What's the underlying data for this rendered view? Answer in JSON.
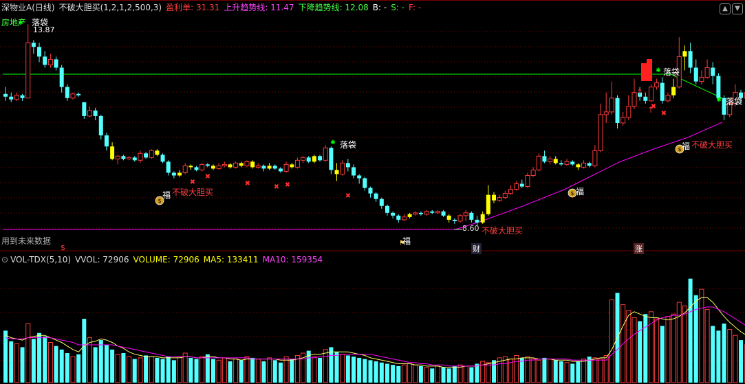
{
  "main_header": {
    "title": "深物业A(日线)",
    "indicator": "不破大胆买(1,2,1,2,500,3)",
    "profit_label": "盈利单",
    "profit_value": "31.31",
    "up_label": "上升趋势线",
    "up_value": "11.47",
    "down_label": "下降趋势线",
    "down_value": "12.08",
    "b_label": "B: -",
    "s_label": "S: -",
    "f_label": "F: -"
  },
  "sector_label": "房地产",
  "price_max_label": "13.87",
  "future_data_note": "用到未来数据",
  "annotations": {
    "luodai": "落袋",
    "fu": "福",
    "buy": "不破大胆买",
    "low_price": "8.60"
  },
  "markers": {
    "m1": "$",
    "m2": "财",
    "m3": "涨"
  },
  "vol_header": {
    "name": "VOL-TDX(5,10)",
    "vvol_label": "VVOL",
    "vvol_value": "72906",
    "volume_label": "VOLUME",
    "volume_value": "72906",
    "ma5_label": "MA5",
    "ma5_value": "133411",
    "ma10_label": "MA10",
    "ma10_value": "159354"
  },
  "colors": {
    "up": "#ff3c3c",
    "down": "#54ffff",
    "yellow": "#ffff00",
    "magenta": "#ff00ff",
    "green": "#00ff00",
    "white": "#ffffff",
    "grid": "#8b0000",
    "ma5": "#ffffff",
    "ma10": "#ff00ff"
  },
  "chart_data": {
    "type": "candlestick",
    "price_label_high": 13.87,
    "price_label_low": 8.6,
    "candles": [
      [
        11.35,
        11.25,
        11.6,
        11.1
      ],
      [
        11.25,
        11.15,
        11.4,
        11.05
      ],
      [
        11.15,
        11.3,
        11.4,
        11.1
      ],
      [
        11.3,
        11.2,
        11.35,
        11.1
      ],
      [
        11.2,
        13.2,
        13.87,
        11.2
      ],
      [
        13.2,
        13.05,
        13.3,
        12.8
      ],
      [
        13.05,
        12.7,
        13.2,
        12.5
      ],
      [
        12.7,
        12.4,
        12.9,
        12.3
      ],
      [
        12.4,
        12.6,
        12.8,
        12.3
      ],
      [
        12.6,
        12.3,
        12.7,
        12.2
      ],
      [
        12.3,
        11.6,
        12.4,
        11.4
      ],
      [
        11.6,
        11.2,
        11.7,
        11.1
      ],
      [
        11.2,
        11.35,
        11.4,
        11.15
      ],
      [
        11.35,
        11.3,
        11.4,
        11.25
      ],
      [
        11.05,
        10.55,
        11.05,
        10.45
      ],
      [
        10.55,
        10.75,
        10.9,
        10.5
      ],
      [
        10.75,
        10.55,
        10.85,
        10.4
      ],
      [
        10.55,
        9.85,
        10.6,
        9.7
      ],
      [
        9.85,
        9.45,
        9.95,
        9.3
      ],
      [
        9.45,
        9.0,
        9.6,
        8.95
      ],
      [
        9.0,
        9.1,
        9.15,
        8.8
      ],
      [
        9.1,
        9.0,
        9.15,
        8.95
      ],
      [
        9.0,
        9.05,
        9.1,
        8.95
      ],
      [
        9.05,
        8.95,
        9.1,
        8.9
      ],
      [
        8.95,
        9.2,
        9.3,
        8.85
      ],
      [
        9.2,
        9.05,
        9.25,
        9.0
      ],
      [
        9.05,
        9.3,
        9.35,
        9.0
      ],
      [
        9.3,
        9.15,
        9.35,
        9.1
      ],
      [
        9.15,
        8.9,
        9.2,
        8.85
      ],
      [
        8.9,
        8.5,
        8.95,
        8.4
      ],
      [
        8.5,
        8.4,
        8.55,
        8.3
      ],
      [
        8.4,
        8.5,
        8.6,
        8.35
      ],
      [
        8.5,
        8.75,
        8.85,
        8.45
      ],
      [
        8.75,
        8.7,
        8.8,
        8.6
      ],
      [
        8.7,
        8.6,
        8.75,
        8.55
      ],
      [
        8.6,
        8.8,
        8.85,
        8.55
      ],
      [
        8.8,
        8.75,
        8.85,
        8.7
      ],
      [
        8.75,
        8.65,
        8.8,
        8.6
      ],
      [
        8.65,
        8.75,
        8.85,
        8.6
      ],
      [
        8.75,
        8.8,
        8.9,
        8.7
      ],
      [
        8.8,
        8.7,
        8.85,
        8.65
      ],
      [
        8.7,
        8.85,
        8.9,
        8.65
      ],
      [
        8.85,
        8.75,
        8.9,
        8.7
      ],
      [
        8.75,
        8.9,
        8.95,
        8.7
      ],
      [
        8.9,
        8.7,
        8.95,
        8.65
      ],
      [
        8.7,
        8.75,
        8.85,
        8.65
      ],
      [
        8.75,
        8.65,
        8.8,
        8.55
      ],
      [
        8.65,
        8.75,
        8.85,
        8.6
      ],
      [
        8.75,
        8.65,
        8.8,
        8.6
      ],
      [
        8.65,
        8.55,
        8.7,
        8.5
      ],
      [
        8.55,
        8.8,
        8.9,
        8.5
      ],
      [
        8.8,
        8.7,
        8.85,
        8.65
      ],
      [
        8.7,
        8.95,
        9.05,
        8.65
      ],
      [
        8.95,
        9.05,
        9.1,
        8.85
      ],
      [
        9.05,
        8.9,
        9.1,
        8.85
      ],
      [
        8.9,
        9.1,
        9.15,
        8.85
      ],
      [
        9.1,
        8.95,
        9.15,
        8.9
      ],
      [
        8.95,
        9.4,
        9.5,
        8.9
      ],
      [
        9.4,
        8.6,
        9.45,
        8.45
      ],
      [
        8.6,
        8.45,
        8.85,
        8.2
      ],
      [
        8.45,
        8.85,
        8.95,
        8.4
      ],
      [
        8.85,
        8.7,
        9.0,
        8.55
      ],
      [
        8.7,
        8.4,
        8.8,
        8.3
      ],
      [
        8.4,
        8.3,
        8.45,
        8.1
      ],
      [
        8.3,
        7.95,
        8.35,
        7.85
      ],
      [
        7.95,
        7.75,
        8.0,
        7.6
      ],
      [
        7.75,
        7.55,
        7.8,
        7.45
      ],
      [
        7.55,
        7.3,
        7.6,
        7.2
      ],
      [
        7.3,
        7.05,
        7.35,
        6.95
      ],
      [
        7.05,
        6.95,
        7.1,
        6.85
      ],
      [
        6.95,
        6.8,
        7.0,
        6.7
      ],
      [
        6.8,
        6.9,
        7.0,
        6.75
      ],
      [
        6.9,
        7.0,
        7.05,
        6.85
      ],
      [
        7.0,
        7.05,
        7.1,
        6.95
      ],
      [
        7.05,
        7.0,
        7.1,
        6.95
      ],
      [
        7.0,
        7.1,
        7.15,
        6.95
      ],
      [
        7.1,
        7.05,
        7.15,
        7.0
      ],
      [
        7.05,
        7.1,
        7.15,
        7.0
      ],
      [
        7.1,
        6.95,
        7.15,
        6.9
      ],
      [
        6.95,
        6.8,
        7.0,
        6.7
      ],
      [
        6.8,
        6.75,
        6.85,
        6.65
      ],
      [
        6.75,
        6.95,
        7.0,
        6.7
      ],
      [
        6.95,
        7.05,
        7.15,
        6.75
      ],
      [
        7.05,
        6.8,
        7.1,
        6.7
      ],
      [
        6.8,
        6.7,
        6.95,
        6.6
      ],
      [
        6.7,
        7.0,
        7.1,
        6.65
      ],
      [
        7.0,
        7.7,
        8.05,
        6.95
      ],
      [
        7.7,
        7.5,
        7.8,
        7.4
      ],
      [
        7.5,
        7.6,
        7.7,
        7.45
      ],
      [
        7.6,
        7.75,
        7.85,
        7.55
      ],
      [
        7.75,
        7.9,
        8.05,
        7.7
      ],
      [
        7.9,
        8.1,
        8.2,
        7.85
      ],
      [
        8.1,
        8.0,
        8.25,
        7.95
      ],
      [
        8.0,
        8.4,
        8.5,
        7.95
      ],
      [
        8.4,
        8.6,
        8.7,
        8.35
      ],
      [
        8.6,
        9.1,
        9.2,
        8.55
      ],
      [
        9.1,
        8.9,
        9.3,
        8.85
      ],
      [
        8.9,
        9.0,
        9.1,
        8.8
      ],
      [
        9.0,
        8.85,
        9.1,
        8.8
      ],
      [
        8.85,
        8.8,
        8.95,
        8.75
      ],
      [
        8.8,
        8.9,
        9.0,
        8.75
      ],
      [
        8.9,
        8.8,
        8.95,
        8.75
      ],
      [
        8.8,
        8.7,
        8.85,
        8.6
      ],
      [
        8.7,
        8.85,
        8.95,
        8.65
      ],
      [
        8.85,
        8.75,
        8.9,
        8.7
      ],
      [
        8.75,
        9.3,
        9.5,
        8.7
      ],
      [
        9.3,
        10.6,
        11.0,
        9.25
      ],
      [
        10.6,
        10.7,
        11.4,
        10.3
      ],
      [
        10.7,
        11.2,
        11.8,
        10.6
      ],
      [
        11.2,
        10.3,
        11.3,
        10.1
      ],
      [
        10.3,
        10.5,
        10.7,
        10.2
      ],
      [
        10.5,
        10.9,
        11.3,
        10.4
      ],
      [
        10.9,
        11.4,
        11.9,
        10.8
      ],
      [
        11.4,
        11.25,
        11.6,
        11.1
      ],
      [
        11.25,
        11.1,
        11.4,
        11.0
      ],
      [
        11.1,
        11.6,
        11.7,
        11.05
      ],
      [
        11.6,
        11.75,
        11.9,
        11.5
      ],
      [
        11.75,
        11.1,
        11.95,
        11.0
      ],
      [
        11.1,
        11.3,
        11.4,
        11.05
      ],
      [
        11.3,
        11.6,
        11.9,
        11.2
      ],
      [
        11.6,
        12.7,
        13.4,
        11.55
      ],
      [
        12.7,
        12.9,
        13.1,
        12.2
      ],
      [
        12.9,
        12.3,
        13.2,
        12.1
      ],
      [
        12.3,
        11.8,
        12.6,
        11.7
      ],
      [
        11.8,
        11.95,
        12.2,
        11.7
      ],
      [
        11.95,
        12.3,
        12.6,
        11.9
      ],
      [
        12.3,
        12.0,
        12.5,
        11.7
      ],
      [
        12.0,
        11.2,
        12.1,
        11.1
      ],
      [
        11.2,
        10.6,
        11.3,
        10.4
      ],
      [
        10.6,
        11.0,
        11.2,
        10.5
      ],
      [
        11.0,
        11.4,
        11.7,
        10.9
      ],
      [
        11.4,
        11.2,
        11.5,
        11.0
      ],
      [
        11.2,
        11.4,
        11.5,
        11.0
      ],
      [
        11.4,
        11.7,
        12.1,
        11.3
      ],
      [
        11.7,
        11.9,
        12.0,
        11.7
      ],
      [
        11.9,
        11.3,
        12.0,
        11.1
      ],
      [
        11.3,
        11.45,
        11.5,
        11.25
      ]
    ],
    "yellow_bars": [
      19,
      27,
      31,
      33,
      37,
      40,
      42,
      44,
      47,
      51,
      55,
      59,
      72,
      79,
      85,
      86,
      87,
      98,
      102,
      119,
      121
    ],
    "volume": [
      44,
      35,
      33,
      30,
      50,
      37,
      42,
      39,
      34,
      31,
      28,
      25,
      22,
      24,
      54,
      38,
      30,
      36,
      32,
      28,
      24,
      25,
      22,
      20,
      21,
      23,
      22,
      21,
      20,
      22,
      19,
      22,
      25,
      21,
      20,
      22,
      24,
      20,
      19,
      21,
      18,
      20,
      19,
      22,
      21,
      20,
      18,
      21,
      19,
      17,
      22,
      20,
      23,
      25,
      27,
      22,
      21,
      28,
      30,
      26,
      24,
      23,
      22,
      21,
      20,
      19,
      18,
      17,
      16,
      15,
      14,
      15,
      16,
      15,
      14,
      13,
      12,
      14,
      13,
      12,
      14,
      15,
      14,
      13,
      16,
      18,
      17,
      19,
      21,
      22,
      20,
      23,
      21,
      22,
      20,
      19,
      21,
      20,
      19,
      18,
      17,
      16,
      18,
      20,
      22,
      21,
      20,
      23,
      70,
      76,
      66,
      61,
      55,
      52,
      58,
      60,
      54,
      48,
      56,
      58,
      68,
      65,
      88,
      74,
      79,
      62,
      48,
      44,
      50,
      45,
      40,
      36,
      32,
      30,
      28,
      26,
      24,
      22,
      20,
      18,
      18
    ],
    "ma5": [
      40,
      38,
      37,
      36,
      38,
      39,
      40,
      40,
      38,
      36,
      34,
      31,
      28,
      26,
      31,
      34,
      35,
      37,
      36,
      34,
      31,
      29,
      26,
      24,
      23,
      22,
      22,
      22,
      21,
      21,
      21,
      21,
      22,
      22,
      21,
      21,
      22,
      22,
      21,
      21,
      20,
      20,
      19,
      20,
      20,
      20,
      20,
      20,
      20,
      19,
      19,
      19,
      20,
      21,
      23,
      24,
      24,
      25,
      26,
      26,
      26,
      26,
      25,
      24,
      23,
      21,
      20,
      19,
      18,
      17,
      16,
      16,
      16,
      15,
      15,
      14,
      14,
      14,
      13,
      13,
      13,
      13,
      14,
      14,
      14,
      15,
      16,
      17,
      18,
      19,
      20,
      20,
      21,
      21,
      21,
      20,
      20,
      20,
      19,
      19,
      19,
      18,
      18,
      18,
      19,
      20,
      21,
      21,
      28,
      38,
      48,
      57,
      60,
      58,
      56,
      55,
      55,
      54,
      53,
      54,
      56,
      59,
      64,
      69,
      72,
      72,
      68,
      62,
      56,
      51,
      47,
      43,
      40,
      37,
      34,
      31,
      29,
      27,
      25,
      23,
      22
    ],
    "ma10": [
      38,
      37,
      37,
      37,
      38,
      38,
      38,
      38,
      38,
      37,
      36,
      35,
      34,
      32,
      32,
      32,
      32,
      32,
      32,
      32,
      31,
      30,
      29,
      28,
      27,
      26,
      25,
      24,
      23,
      22,
      22,
      22,
      22,
      22,
      21,
      21,
      21,
      21,
      21,
      21,
      21,
      21,
      21,
      21,
      20,
      20,
      20,
      20,
      20,
      20,
      20,
      20,
      20,
      20,
      21,
      21,
      22,
      22,
      23,
      23,
      24,
      24,
      24,
      24,
      24,
      24,
      23,
      22,
      21,
      20,
      19,
      18,
      17,
      17,
      16,
      16,
      15,
      15,
      15,
      14,
      14,
      14,
      14,
      14,
      14,
      15,
      15,
      15,
      16,
      16,
      17,
      18,
      18,
      19,
      19,
      20,
      20,
      20,
      20,
      20,
      20,
      19,
      19,
      19,
      19,
      19,
      19,
      19,
      24,
      28,
      33,
      37,
      41,
      44,
      47,
      50,
      53,
      55,
      56,
      57,
      57,
      58,
      60,
      62,
      63,
      64,
      64,
      62,
      60,
      57,
      54,
      51,
      48,
      45,
      43,
      40,
      37,
      35,
      33,
      31,
      30
    ]
  }
}
